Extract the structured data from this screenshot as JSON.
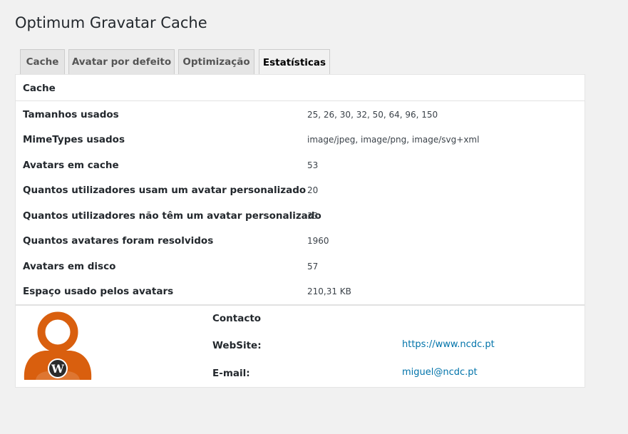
{
  "page": {
    "title": "Optimum Gravatar Cache"
  },
  "tabs": [
    {
      "label": "Cache"
    },
    {
      "label": "Avatar por defeito"
    },
    {
      "label": "Optimização"
    },
    {
      "label": "Estatísticas",
      "active": true
    }
  ],
  "stats": {
    "section_title": "Cache",
    "rows": [
      {
        "label": "Tamanhos usados",
        "value": "25, 26, 30, 32, 50, 64, 96, 150"
      },
      {
        "label": "MimeTypes usados",
        "value": "image/jpeg, image/png, image/svg+xml"
      },
      {
        "label": "Avatars em cache",
        "value": "53"
      },
      {
        "label": "Quantos utilizadores usam um avatar personalizado",
        "value": "20"
      },
      {
        "label": "Quantos utilizadores não têm um avatar personalizado",
        "value": "33"
      },
      {
        "label": "Quantos avatares foram resolvidos",
        "value": "1960"
      },
      {
        "label": "Avatars em disco",
        "value": "57"
      },
      {
        "label": "Espaço usado pelos avatars",
        "value": "210,31 KB"
      }
    ]
  },
  "contact": {
    "heading": "Contacto",
    "website_label": "WebSite:",
    "website_value": "https://www.ncdc.pt",
    "email_label": "E-mail:",
    "email_value": "miguel@ncdc.pt"
  },
  "colors": {
    "accent_orange": "#d95f0e",
    "link_blue": "#0073aa",
    "background": "#f1f1f1"
  },
  "icons": {
    "logo": "gravatar-person-wordpress-icon"
  }
}
